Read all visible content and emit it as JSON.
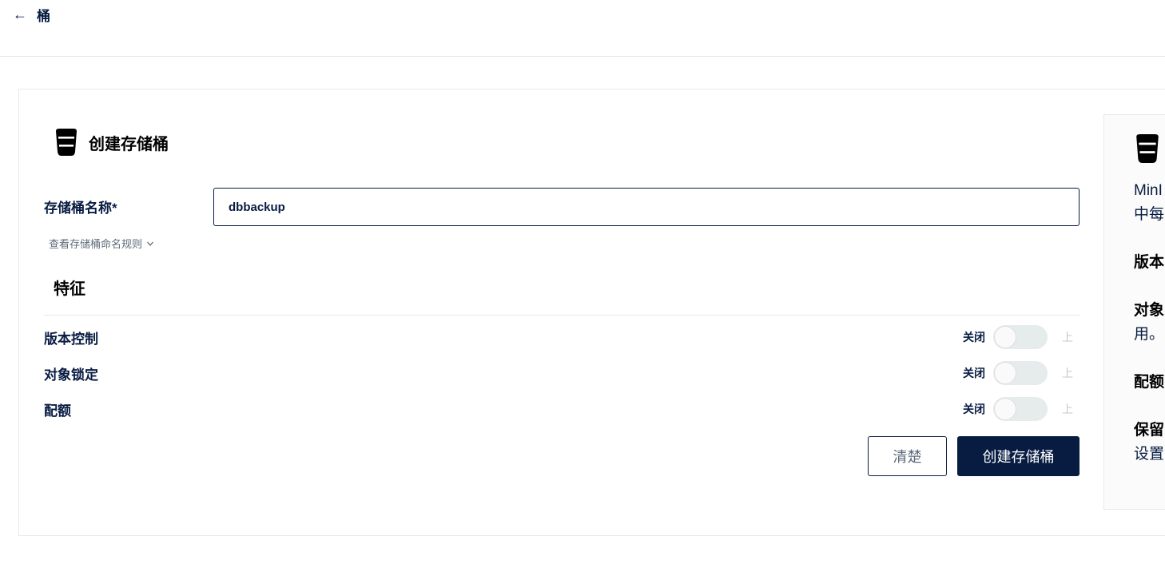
{
  "topbar": {
    "back_icon": "arrow-left-icon",
    "back_label": "桶"
  },
  "form": {
    "title": "创建存储桶",
    "title_icon": "bucket-icon",
    "name_label": "存储桶名称*",
    "name_value": "dbbackup",
    "rules_link": "查看存储桶命名规则",
    "rules_icon": "chevron-down-icon"
  },
  "features": {
    "title": "特征",
    "items": [
      {
        "label": "版本控制",
        "off_label": "关闭",
        "on_label": "上",
        "enabled": false
      },
      {
        "label": "对象锁定",
        "off_label": "关闭",
        "on_label": "上",
        "enabled": false
      },
      {
        "label": "配额",
        "off_label": "关闭",
        "on_label": "上",
        "enabled": false
      }
    ]
  },
  "actions": {
    "clear_label": "清楚",
    "create_label": "创建存储桶"
  },
  "help": {
    "icon": "bucket-icon",
    "line1": "MinI",
    "line2": "中每",
    "versioning_head": "版本",
    "object_lock_head": "对象",
    "object_lock_text": "用。",
    "quota_head": "配额",
    "retention_head": "保留",
    "retention_text": "设置"
  },
  "colors": {
    "primary": "#081c42",
    "border": "#e6e8ea",
    "toggle_track": "#e6ebeb",
    "muted": "#5e6b7a"
  }
}
